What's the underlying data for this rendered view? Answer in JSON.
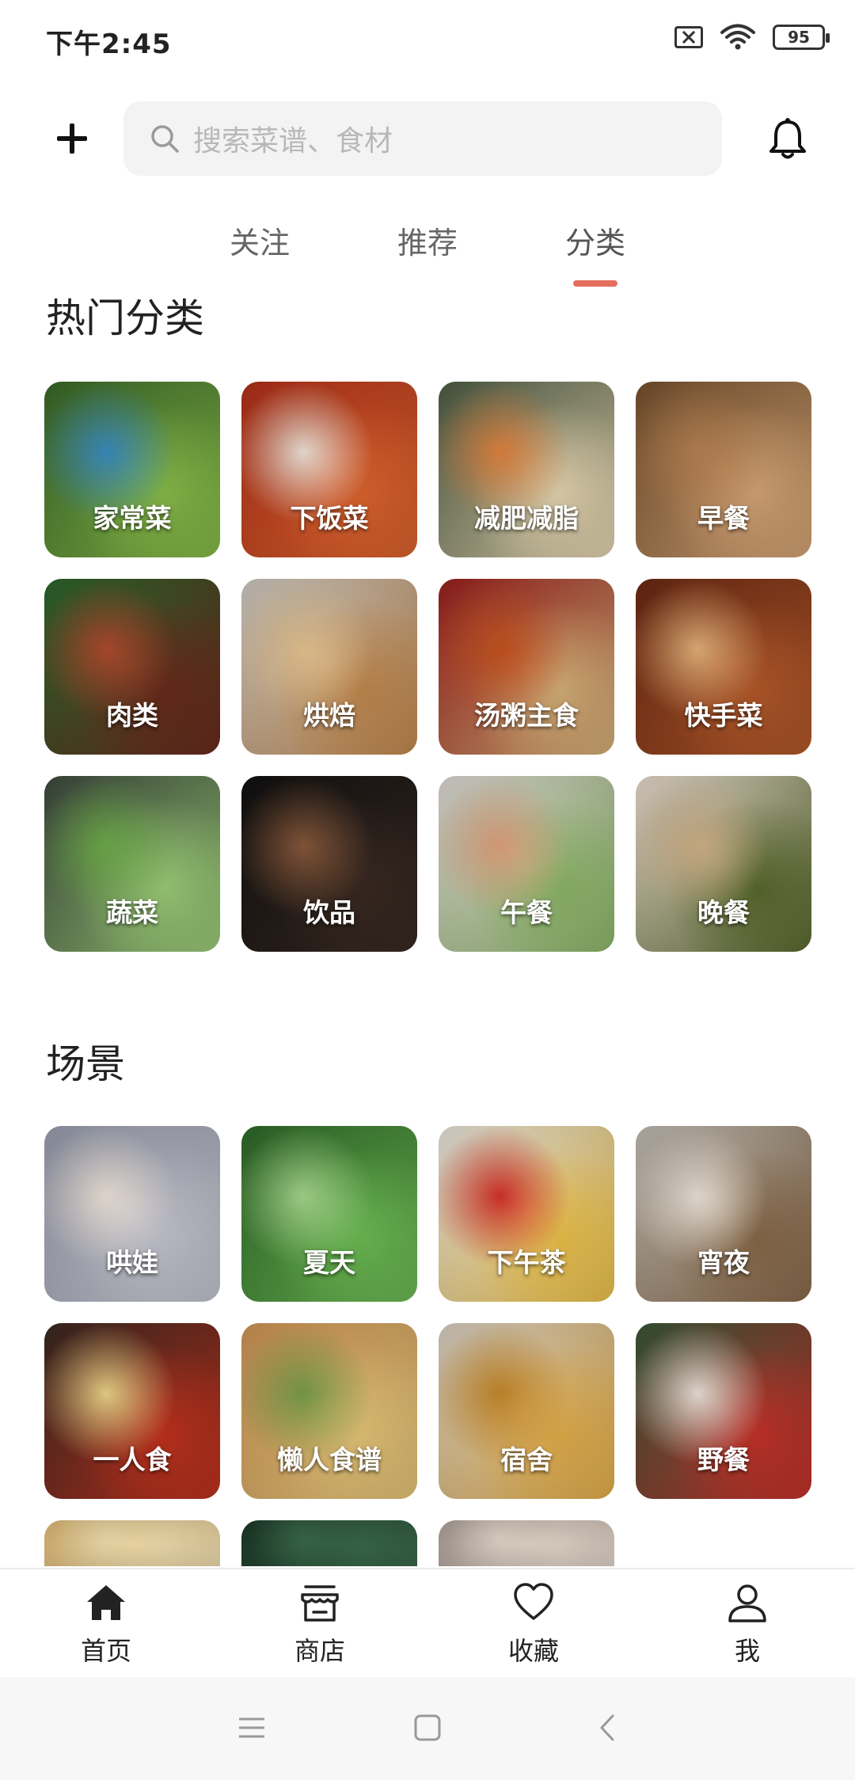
{
  "status_bar": {
    "time": "下午2:45",
    "battery": "95",
    "icons": [
      "sim-off-icon",
      "wifi-icon",
      "battery-icon"
    ]
  },
  "top_bar": {
    "add_icon": "plus-icon",
    "search_placeholder": "搜索菜谱、食材",
    "notification_icon": "bell-icon"
  },
  "tabs": [
    {
      "label": "关注",
      "active": false
    },
    {
      "label": "推荐",
      "active": false
    },
    {
      "label": "分类",
      "active": true
    }
  ],
  "accent_color": "#e56e5c",
  "hot_categories": {
    "title": "热门分类",
    "items": [
      {
        "label": "家常菜",
        "colors": [
          "#3a6b2a",
          "#8bbf4a",
          "#3b8ec4"
        ]
      },
      {
        "label": "下饭菜",
        "colors": [
          "#b8321a",
          "#e0662f",
          "#f2e7dc"
        ]
      },
      {
        "label": "减肥减脂",
        "colors": [
          "#4f5f46",
          "#e9d9b4",
          "#e3843e"
        ]
      },
      {
        "label": "早餐",
        "colors": [
          "#7a5330",
          "#d9a878",
          "#b98252"
        ]
      },
      {
        "label": "肉类",
        "colors": [
          "#2e6b2e",
          "#6b2a1c",
          "#b34b2e"
        ]
      },
      {
        "label": "烘焙",
        "colors": [
          "#d8d3cc",
          "#c48a4e",
          "#e9c793"
        ]
      },
      {
        "label": "汤粥主食",
        "colors": [
          "#a01f1f",
          "#d9b47a",
          "#c8531f"
        ]
      },
      {
        "label": "快手菜",
        "colors": [
          "#6e2a14",
          "#b65a2a",
          "#e7b37a"
        ]
      },
      {
        "label": "蔬菜",
        "colors": [
          "#3d4a3f",
          "#9fd07a",
          "#6fae4a"
        ]
      },
      {
        "label": "饮品",
        "colors": [
          "#111111",
          "#3a2a22",
          "#8a5a3c"
        ]
      },
      {
        "label": "午餐",
        "colors": [
          "#e8e2de",
          "#8fb96a",
          "#e3a37d"
        ]
      },
      {
        "label": "晚餐",
        "colors": [
          "#f3e6d8",
          "#5a6a2e",
          "#d4b48a"
        ]
      }
    ]
  },
  "scenes": {
    "title": "场景",
    "items": [
      {
        "label": "哄娃",
        "colors": [
          "#9fa3b4",
          "#c7c8d2",
          "#f1e6dc"
        ]
      },
      {
        "label": "夏天",
        "colors": [
          "#2f6b2a",
          "#6fbf55",
          "#a8d98f"
        ]
      },
      {
        "label": "下午茶",
        "colors": [
          "#f2eee8",
          "#f0c44a",
          "#d8322a"
        ]
      },
      {
        "label": "宵夜",
        "colors": [
          "#c9c4bc",
          "#8a6a4a",
          "#efe7dc"
        ]
      },
      {
        "label": "一人食",
        "colors": [
          "#3a2a22",
          "#c4321e",
          "#f0d88a"
        ]
      },
      {
        "label": "懒人食谱",
        "colors": [
          "#d79a5a",
          "#e8c87a",
          "#7aa04a"
        ]
      },
      {
        "label": "宿舍",
        "colors": [
          "#e3d9cc",
          "#e6b04a",
          "#c88a2a"
        ]
      },
      {
        "label": "野餐",
        "colors": [
          "#3a5a3a",
          "#c8322a",
          "#efe6dc"
        ]
      }
    ],
    "partial_items": [
      {
        "colors": [
          "#e8c27a",
          "#f3e0b0"
        ]
      },
      {
        "colors": [
          "#1e3a2a",
          "#3a6a4a"
        ]
      },
      {
        "colors": [
          "#b4a8a0",
          "#e6d8cc"
        ]
      }
    ]
  },
  "bottom_nav": [
    {
      "label": "首页",
      "icon": "home-icon",
      "active": true
    },
    {
      "label": "商店",
      "icon": "store-icon",
      "active": false
    },
    {
      "label": "收藏",
      "icon": "heart-icon",
      "active": false
    },
    {
      "label": "我",
      "icon": "user-icon",
      "active": false
    }
  ],
  "system_nav": [
    "menu-icon",
    "home-square-icon",
    "back-icon"
  ]
}
